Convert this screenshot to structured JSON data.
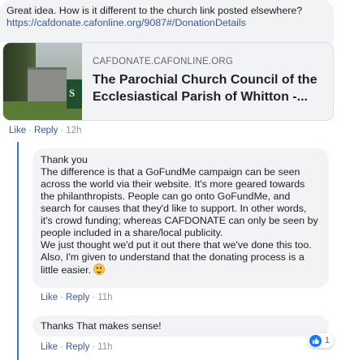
{
  "comment1": {
    "text": "Great idea. How is it different to the church link posted elsewhere?",
    "link": "https://cafdonate.cafonline.org/9087#/DonationDetails"
  },
  "link_card": {
    "domain": "CAFDONATE.CAFONLINE.ORG",
    "title": "The Parochial Church Council of the Ecclesiastical Parish of Whitton -...",
    "thumb_letter": "S"
  },
  "actions1": {
    "like": "Like",
    "reply": "Reply",
    "sep": "·",
    "time": "12h"
  },
  "reply1": {
    "lines": [
      "Thank you",
      "The difference is that a GoFundMe campaign can be seen across the world via their website. It's more geared towards the philanthropists. People can go onto GoFundMe, and search for causes that they'd like to support. In other words, it's crowd funding; whereas CAFDONATE can only be seen by people included in a share/local publicity.",
      "We just thought we'd put it out there that we've done this too. Also, I'm given to understand that the donating process is a little easier."
    ]
  },
  "actions2": {
    "like": "Like",
    "reply": "Reply",
    "sep": "·",
    "time": "11h"
  },
  "reply2": {
    "text": "Thanks That makes sense!"
  },
  "actions3": {
    "like": "Like",
    "reply": "Reply",
    "sep": "·",
    "time": "11h"
  },
  "reaction": {
    "icon": "like-icon",
    "count": "1",
    "color": "#1877f2"
  },
  "colors": {
    "link": "#385898",
    "bubble": "#f2f3f5",
    "thread_line": "#3578e5"
  }
}
